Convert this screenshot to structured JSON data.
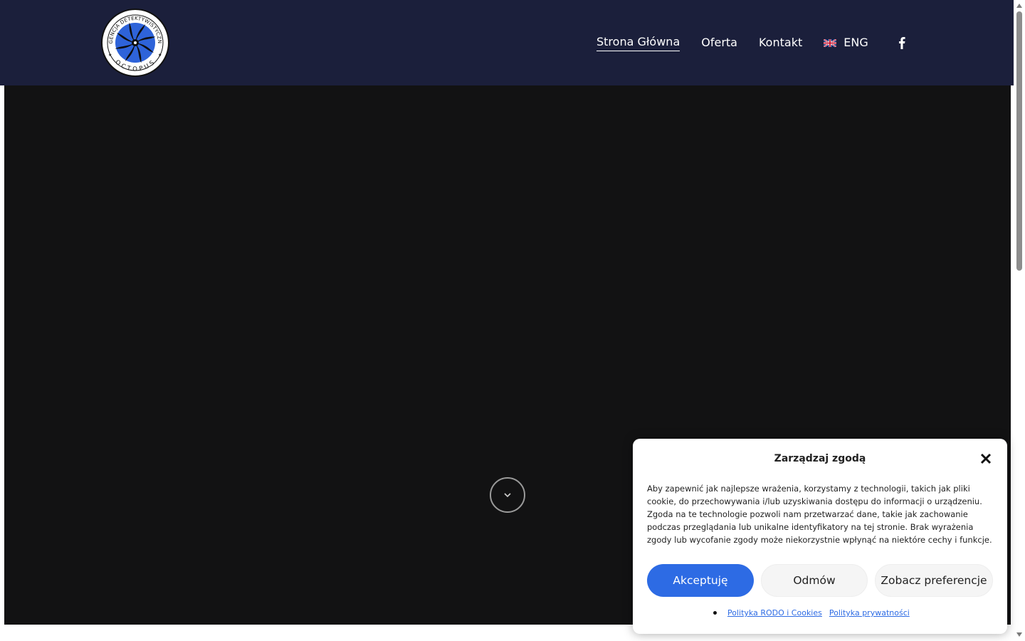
{
  "header": {
    "logo_text_top": "AGENCJA DETEKTYWISTYCZNA",
    "logo_text_bottom": "OCTOPUS",
    "nav": {
      "home": "Strona Główna",
      "offer": "Oferta",
      "contact": "Kontakt",
      "language": "ENG"
    },
    "icons": {
      "flag": "uk-flag-icon",
      "social": "facebook-icon"
    }
  },
  "hero": {
    "scroll_icon": "chevron-down-icon"
  },
  "cookie": {
    "title": "Zarządzaj zgodą",
    "text": "Aby zapewnić jak najlepsze wrażenia, korzystamy z technologii, takich jak pliki cookie, do przechowywania i/lub uzyskiwania dostępu do informacji o urządzeniu. Zgoda na te technologie pozwoli nam przetwarzać dane, takie jak zachowanie podczas przeglądania lub unikalne identyfikatory na tej stronie. Brak wyrażenia zgody lub wycofanie zgody może niekorzystnie wpłynąć na niektóre cechy i funkcje.",
    "accept": "Akceptuję",
    "deny": "Odmów",
    "preferences": "Zobacz preferencje",
    "link_rodo": "Polityka RODO i Cookies",
    "link_privacy": "Polityka prywatności"
  },
  "colors": {
    "header_bg": "#1b1f3b",
    "hero_bg": "#121213",
    "accent": "#2d6be4"
  }
}
